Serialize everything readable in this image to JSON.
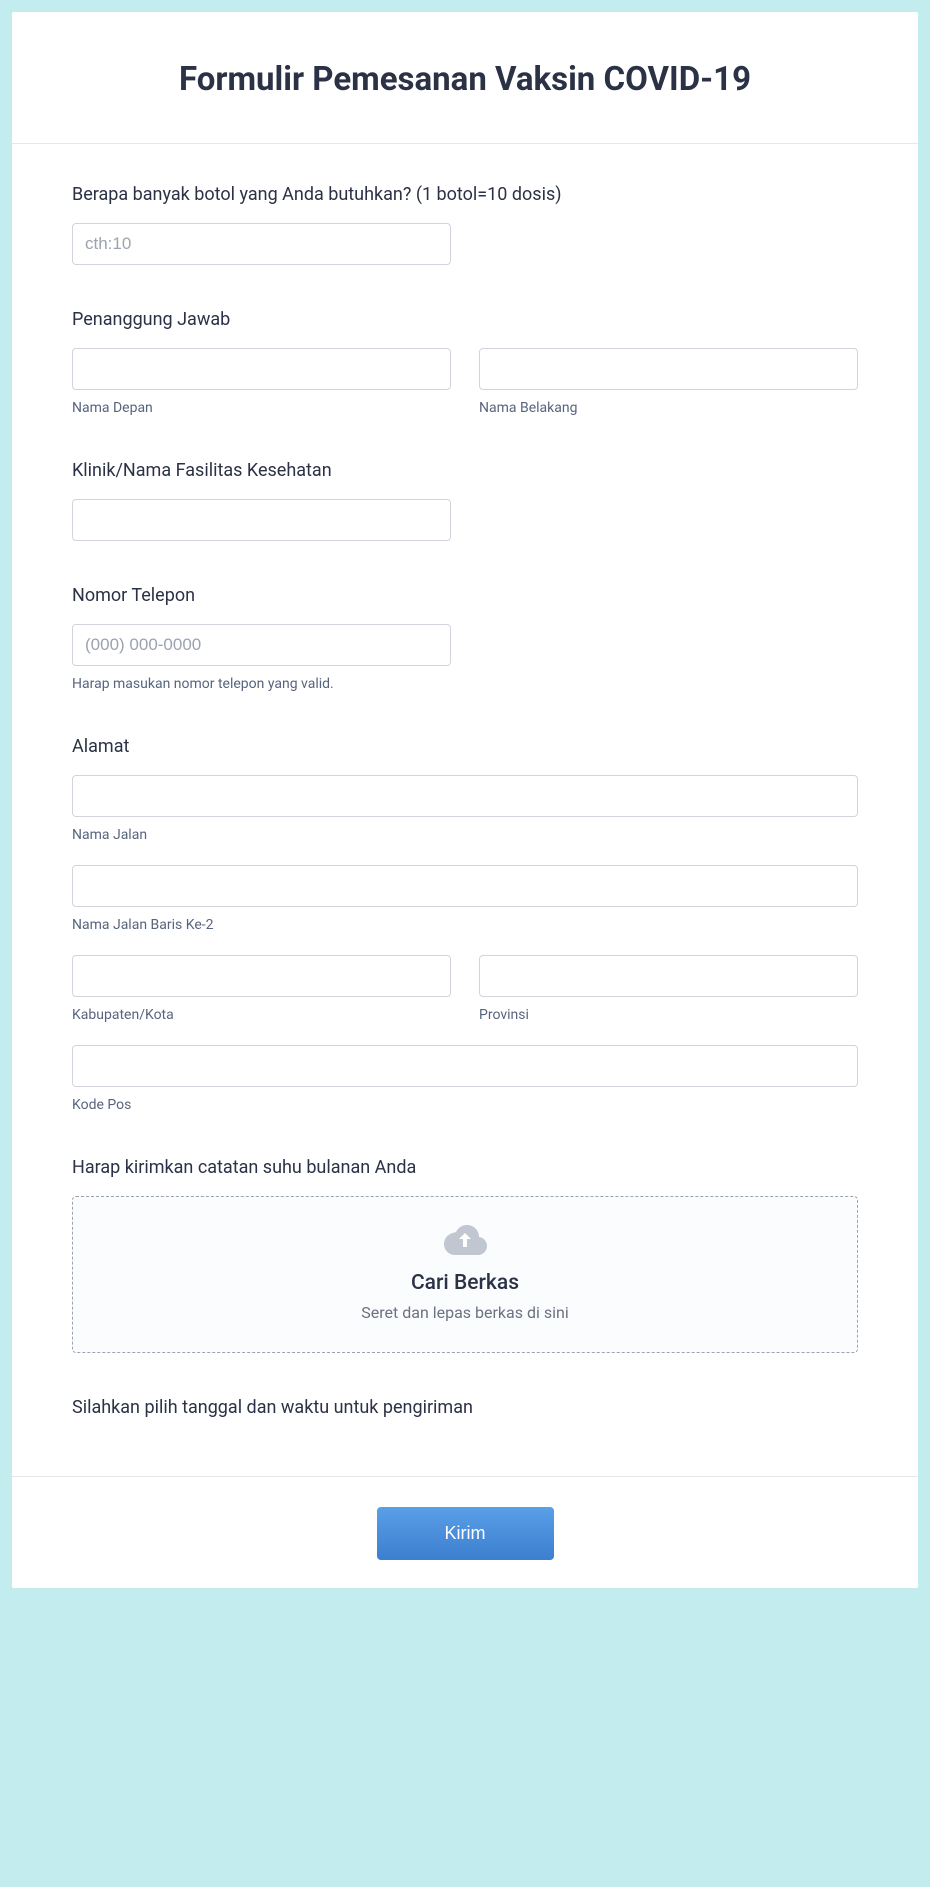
{
  "header": {
    "title": "Formulir Pemesanan Vaksin COVID-19"
  },
  "quantity": {
    "label": "Berapa banyak botol yang Anda butuhkan? (1 botol=10 dosis)",
    "placeholder": "cth:10"
  },
  "responsible": {
    "label": "Penanggung Jawab",
    "first_sublabel": "Nama Depan",
    "last_sublabel": "Nama Belakang"
  },
  "clinic": {
    "label": "Klinik/Nama Fasilitas Kesehatan"
  },
  "phone": {
    "label": "Nomor Telepon",
    "placeholder": "(000) 000-0000",
    "sublabel": "Harap masukan nomor telepon yang valid."
  },
  "address": {
    "label": "Alamat",
    "street_sublabel": "Nama Jalan",
    "street2_sublabel": "Nama Jalan Baris Ke-2",
    "city_sublabel": "Kabupaten/Kota",
    "province_sublabel": "Provinsi",
    "postal_sublabel": "Kode Pos"
  },
  "upload": {
    "label": "Harap kirimkan catatan suhu bulanan Anda",
    "title": "Cari Berkas",
    "sub": "Seret dan lepas berkas di sini"
  },
  "datetime": {
    "label": "Silahkan pilih tanggal dan waktu untuk pengiriman"
  },
  "footer": {
    "submit": "Kirim"
  }
}
